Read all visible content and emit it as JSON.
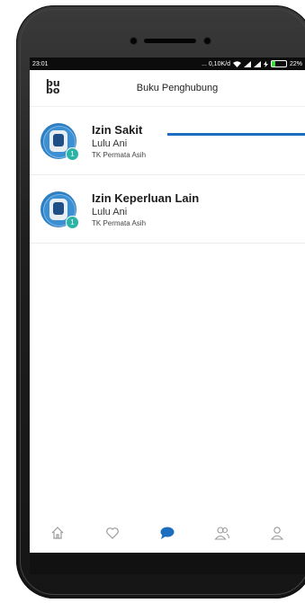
{
  "status_bar": {
    "time": "23:01",
    "network_speed": "... 0,10K/d",
    "battery_percent": "22%",
    "battery_level": 0.22,
    "icons": [
      "wifi-icon",
      "signal-icon",
      "signal-icon",
      "charging-icon",
      "battery-icon"
    ]
  },
  "header": {
    "logo": "bu\nbo",
    "title": "Buku Penghubung"
  },
  "messages": [
    {
      "title": "Izin Sakit",
      "name": "Lulu Ani",
      "school": "TK Permata Asih",
      "badge": "1"
    },
    {
      "title": "Izin Keperluan Lain",
      "name": "Lulu Ani",
      "school": "TK Permata Asih",
      "badge": "1"
    }
  ],
  "bottom_nav": [
    {
      "icon": "home-icon",
      "active": false
    },
    {
      "icon": "heart-icon",
      "active": false
    },
    {
      "icon": "chat-icon",
      "active": true
    },
    {
      "icon": "contacts-icon",
      "active": false
    },
    {
      "icon": "profile-icon",
      "active": false
    }
  ],
  "colors": {
    "accent": "#1a6dbf",
    "badge": "#29b4a6",
    "inactive_icon": "#9a9a9a"
  }
}
